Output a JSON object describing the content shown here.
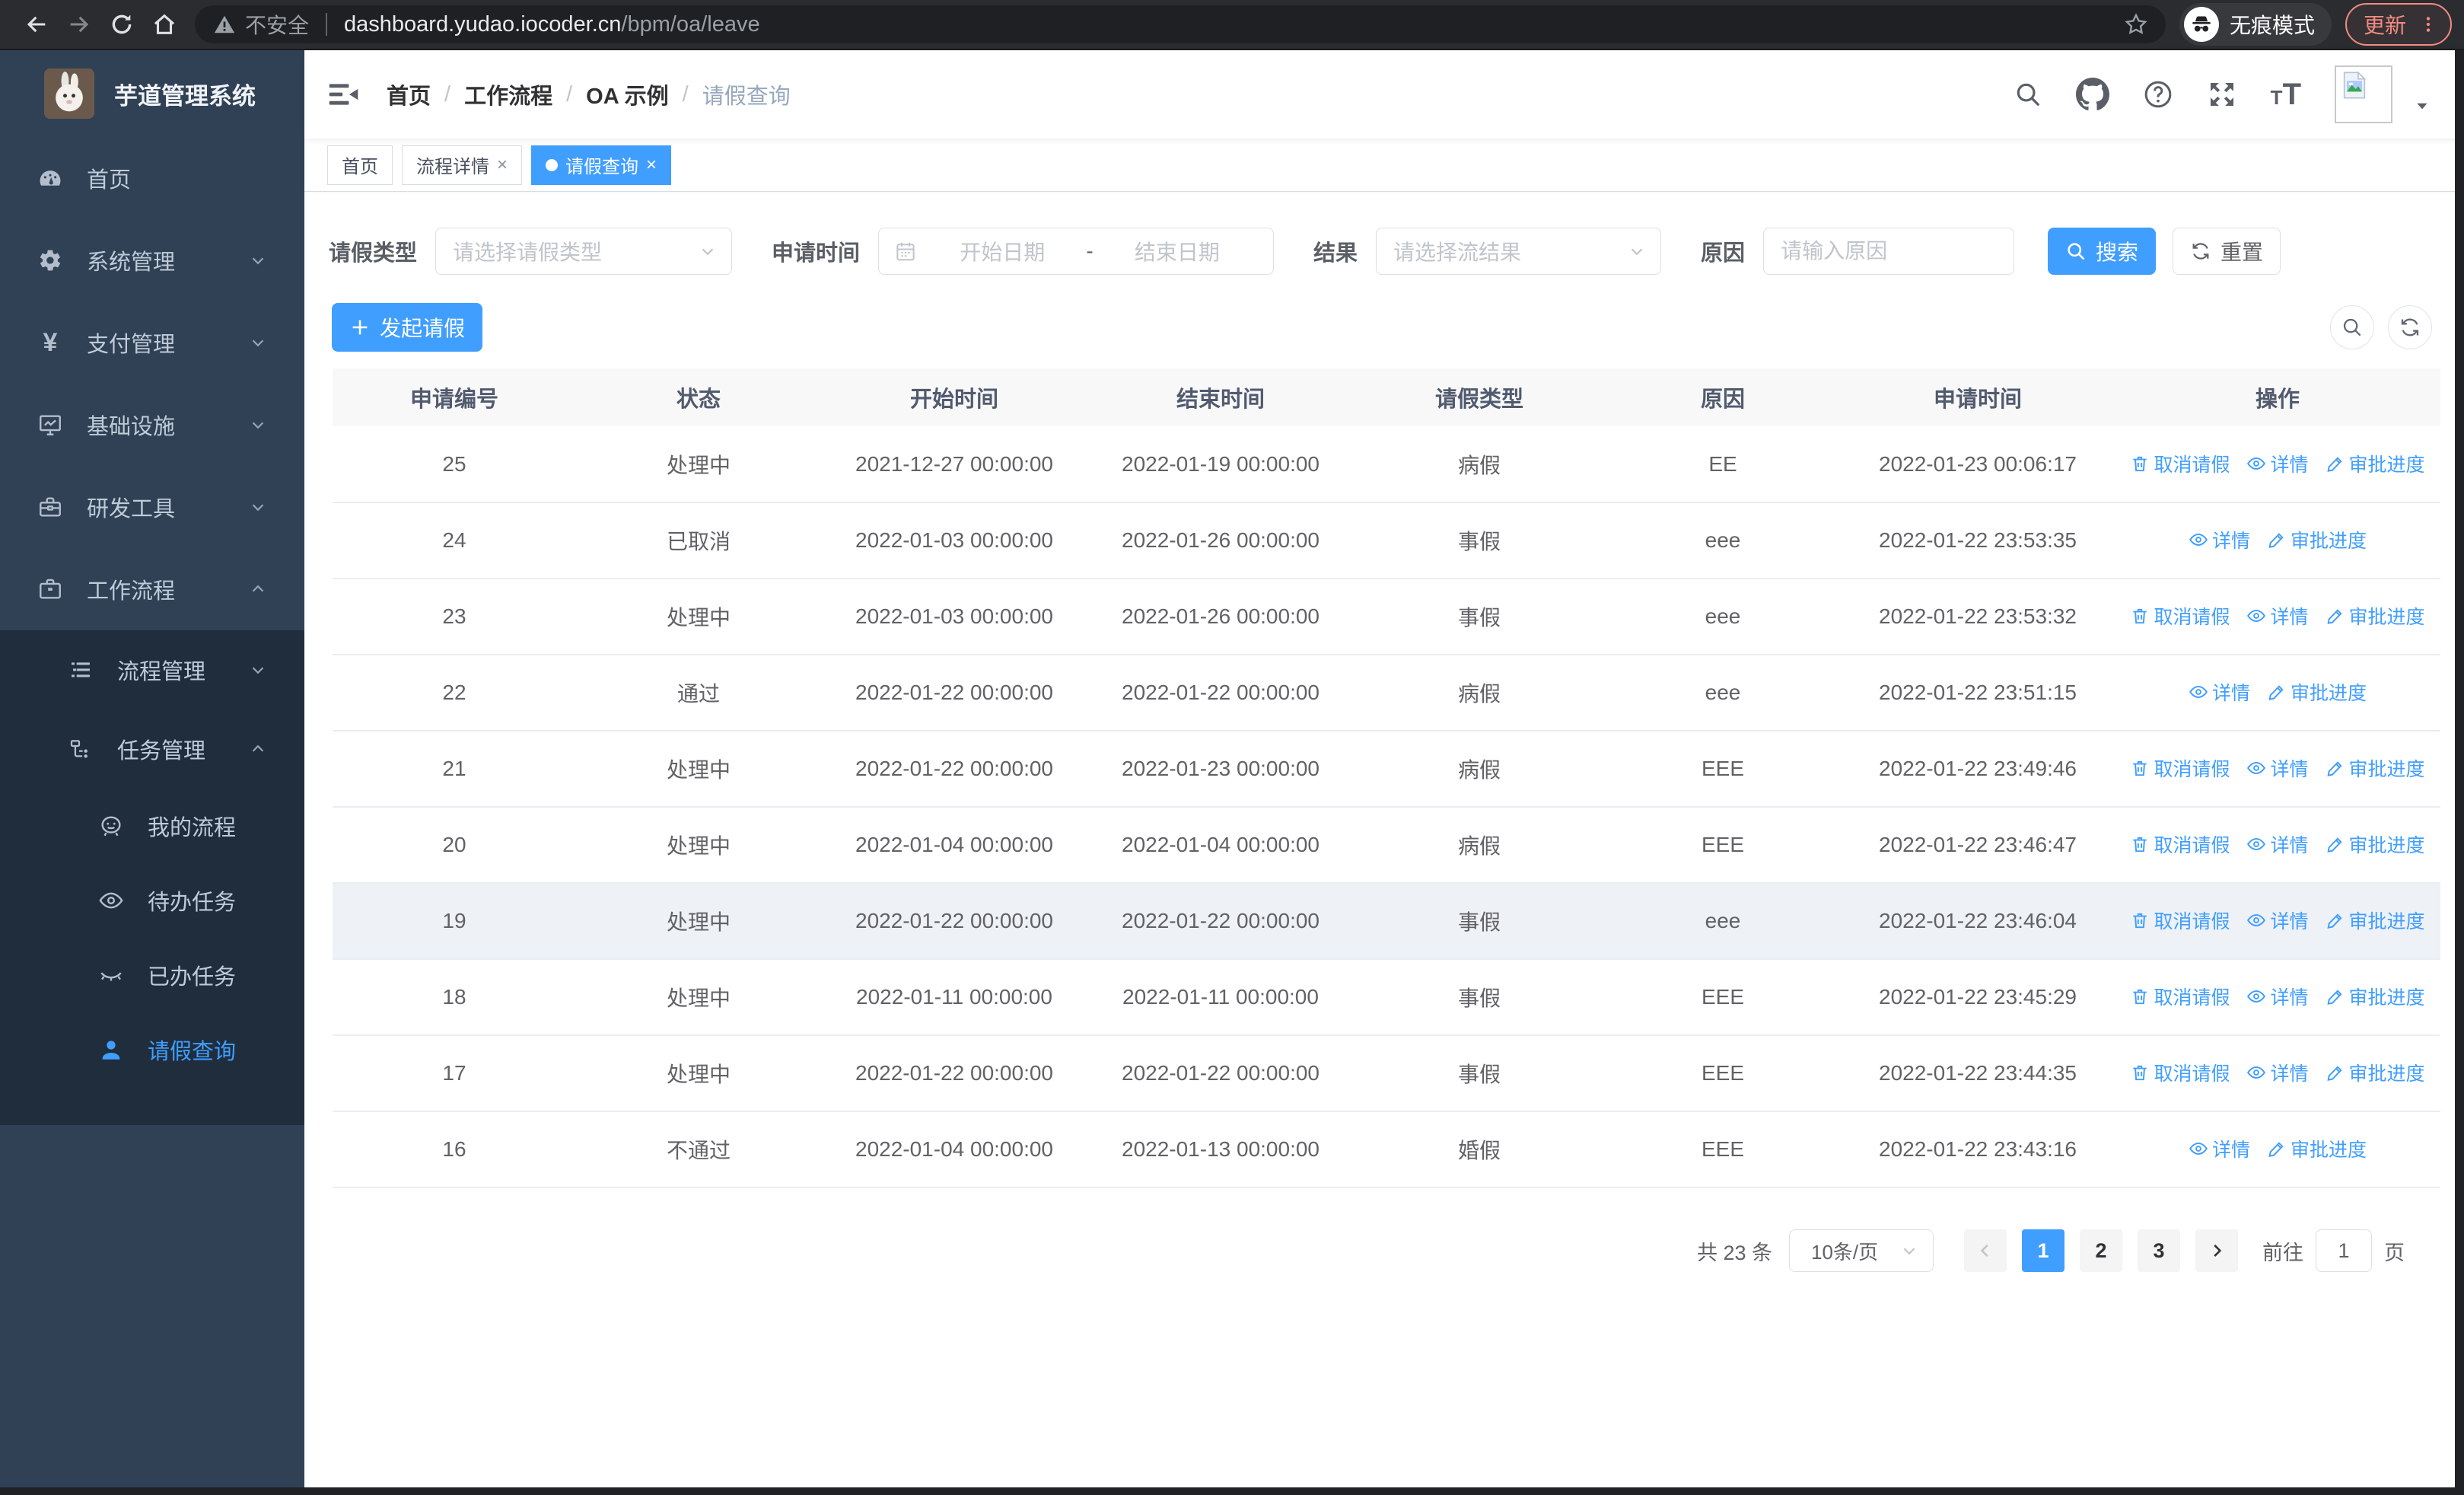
{
  "browser": {
    "security_warning": "不安全",
    "url_host": "dashboard.yudao.iocoder.cn",
    "url_path": "/bpm/oa/leave",
    "incognito_label": "无痕模式",
    "update_label": "更新"
  },
  "sidebar": {
    "title": "芋道管理系统",
    "items": [
      {
        "label": "首页",
        "icon": "dashboard-icon",
        "level": 1
      },
      {
        "label": "系统管理",
        "icon": "gear-icon",
        "level": 1,
        "arrow": "down"
      },
      {
        "label": "支付管理",
        "icon": "yen-icon",
        "level": 1,
        "arrow": "down"
      },
      {
        "label": "基础设施",
        "icon": "monitor-icon",
        "level": 1,
        "arrow": "down"
      },
      {
        "label": "研发工具",
        "icon": "toolbox-icon",
        "level": 1,
        "arrow": "down"
      },
      {
        "label": "工作流程",
        "icon": "briefcase-icon",
        "level": 1,
        "arrow": "up"
      },
      {
        "label": "流程管理",
        "icon": "list-icon",
        "level": 2,
        "arrow": "down",
        "dark": true
      },
      {
        "label": "任务管理",
        "icon": "flow-icon",
        "level": 2,
        "arrow": "up",
        "dark": true
      },
      {
        "label": "我的流程",
        "icon": "face-icon",
        "level": 3,
        "dark": true
      },
      {
        "label": "待办任务",
        "icon": "eye-icon",
        "level": 3,
        "dark": true
      },
      {
        "label": "已办任务",
        "icon": "eye-closed-icon",
        "level": 3,
        "dark": true
      },
      {
        "label": "请假查询",
        "icon": "user-icon",
        "level": 3,
        "dark": true,
        "active": true
      }
    ]
  },
  "header": {
    "breadcrumb": [
      "首页",
      "工作流程",
      "OA 示例",
      "请假查询"
    ]
  },
  "tabs": [
    {
      "label": "首页",
      "closable": false,
      "active": false
    },
    {
      "label": "流程详情",
      "closable": true,
      "active": false
    },
    {
      "label": "请假查询",
      "closable": true,
      "active": true
    }
  ],
  "filters": {
    "leave_type": {
      "label": "请假类型",
      "placeholder": "请选择请假类型"
    },
    "apply_time": {
      "label": "申请时间",
      "start_placeholder": "开始日期",
      "separator": "-",
      "end_placeholder": "结束日期"
    },
    "result": {
      "label": "结果",
      "placeholder": "请选择流结果"
    },
    "reason": {
      "label": "原因",
      "placeholder": "请输入原因"
    },
    "search_label": "搜索",
    "reset_label": "重置"
  },
  "toolbar": {
    "create_label": "发起请假"
  },
  "table": {
    "columns": [
      "申请编号",
      "状态",
      "开始时间",
      "结束时间",
      "请假类型",
      "原因",
      "申请时间",
      "操作"
    ],
    "action_labels": {
      "cancel": "取消请假",
      "detail": "详情",
      "progress": "审批进度"
    },
    "rows": [
      {
        "id": "25",
        "status": "处理中",
        "start": "2021-12-27 00:00:00",
        "end": "2022-01-19 00:00:00",
        "type": "病假",
        "reason": "EE",
        "apply": "2022-01-23 00:06:17",
        "actions": [
          "cancel",
          "detail",
          "progress"
        ],
        "highlight": false
      },
      {
        "id": "24",
        "status": "已取消",
        "start": "2022-01-03 00:00:00",
        "end": "2022-01-26 00:00:00",
        "type": "事假",
        "reason": "eee",
        "apply": "2022-01-22 23:53:35",
        "actions": [
          "detail",
          "progress"
        ],
        "highlight": false
      },
      {
        "id": "23",
        "status": "处理中",
        "start": "2022-01-03 00:00:00",
        "end": "2022-01-26 00:00:00",
        "type": "事假",
        "reason": "eee",
        "apply": "2022-01-22 23:53:32",
        "actions": [
          "cancel",
          "detail",
          "progress"
        ],
        "highlight": false
      },
      {
        "id": "22",
        "status": "通过",
        "start": "2022-01-22 00:00:00",
        "end": "2022-01-22 00:00:00",
        "type": "病假",
        "reason": "eee",
        "apply": "2022-01-22 23:51:15",
        "actions": [
          "detail",
          "progress"
        ],
        "highlight": false
      },
      {
        "id": "21",
        "status": "处理中",
        "start": "2022-01-22 00:00:00",
        "end": "2022-01-23 00:00:00",
        "type": "病假",
        "reason": "EEE",
        "apply": "2022-01-22 23:49:46",
        "actions": [
          "cancel",
          "detail",
          "progress"
        ],
        "highlight": false
      },
      {
        "id": "20",
        "status": "处理中",
        "start": "2022-01-04 00:00:00",
        "end": "2022-01-04 00:00:00",
        "type": "病假",
        "reason": "EEE",
        "apply": "2022-01-22 23:46:47",
        "actions": [
          "cancel",
          "detail",
          "progress"
        ],
        "highlight": false
      },
      {
        "id": "19",
        "status": "处理中",
        "start": "2022-01-22 00:00:00",
        "end": "2022-01-22 00:00:00",
        "type": "事假",
        "reason": "eee",
        "apply": "2022-01-22 23:46:04",
        "actions": [
          "cancel",
          "detail",
          "progress"
        ],
        "highlight": true
      },
      {
        "id": "18",
        "status": "处理中",
        "start": "2022-01-11 00:00:00",
        "end": "2022-01-11 00:00:00",
        "type": "事假",
        "reason": "EEE",
        "apply": "2022-01-22 23:45:29",
        "actions": [
          "cancel",
          "detail",
          "progress"
        ],
        "highlight": false
      },
      {
        "id": "17",
        "status": "处理中",
        "start": "2022-01-22 00:00:00",
        "end": "2022-01-22 00:00:00",
        "type": "事假",
        "reason": "EEE",
        "apply": "2022-01-22 23:44:35",
        "actions": [
          "cancel",
          "detail",
          "progress"
        ],
        "highlight": false
      },
      {
        "id": "16",
        "status": "不通过",
        "start": "2022-01-04 00:00:00",
        "end": "2022-01-13 00:00:00",
        "type": "婚假",
        "reason": "EEE",
        "apply": "2022-01-22 23:43:16",
        "actions": [
          "detail",
          "progress"
        ],
        "highlight": false
      }
    ]
  },
  "pagination": {
    "total_label": "共 23 条",
    "page_size_value": "10条/页",
    "pages": [
      "1",
      "2",
      "3"
    ],
    "active_page": "1",
    "goto_label": "前往",
    "goto_value": "1",
    "page_unit_label": "页"
  },
  "colors": {
    "accent": "#409eff",
    "sidebar": "#304156",
    "submenu": "#1f2d3d",
    "update_red": "#f28b82"
  }
}
